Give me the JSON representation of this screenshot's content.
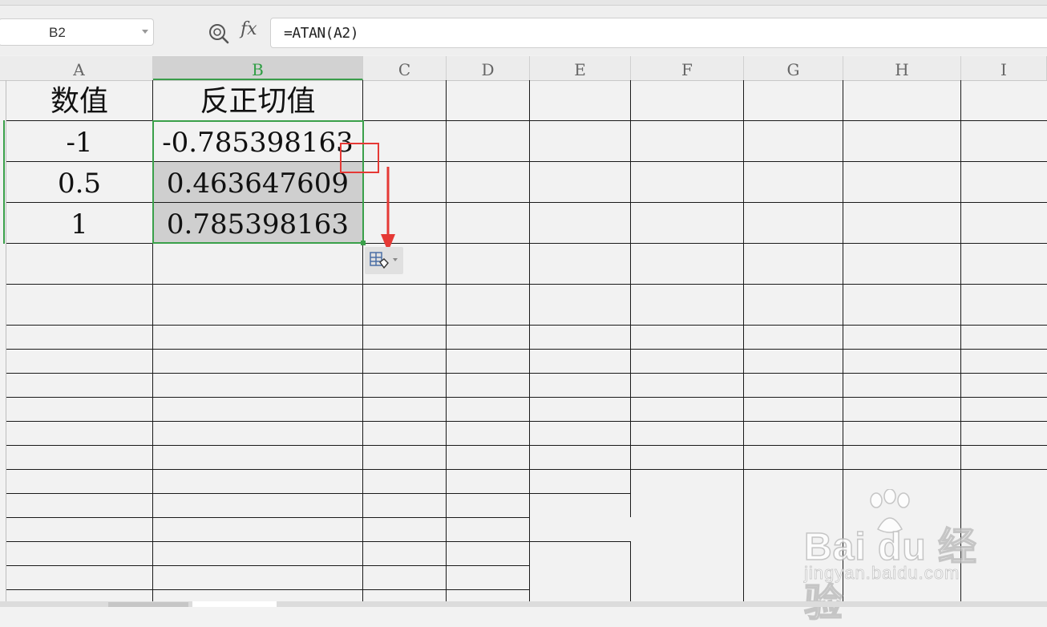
{
  "name_box": {
    "value": "B2"
  },
  "formula_bar": {
    "fx_label": "fx",
    "formula": "=ATAN(A2)"
  },
  "columns": [
    "A",
    "B",
    "C",
    "D",
    "E",
    "F",
    "G",
    "H",
    "I"
  ],
  "selected_column": "B",
  "table": {
    "headers": [
      "数值",
      "反正切值"
    ],
    "rows": [
      {
        "a": "-1",
        "b": "-0.785398163"
      },
      {
        "a": "0.5",
        "b": "0.463647609"
      },
      {
        "a": "1",
        "b": "0.785398163"
      }
    ]
  },
  "watermark": {
    "logo": "Bai du 经验",
    "url": "jingyan.baidu.com"
  },
  "colors": {
    "selection": "#3aa04a",
    "annotation": "#e53935",
    "selected_fill": "#cfcfcf"
  },
  "icons": {
    "zoom": "zoom-search-icon",
    "paste_options": "paste-options-icon",
    "dropdown": "chevron-down-icon"
  }
}
